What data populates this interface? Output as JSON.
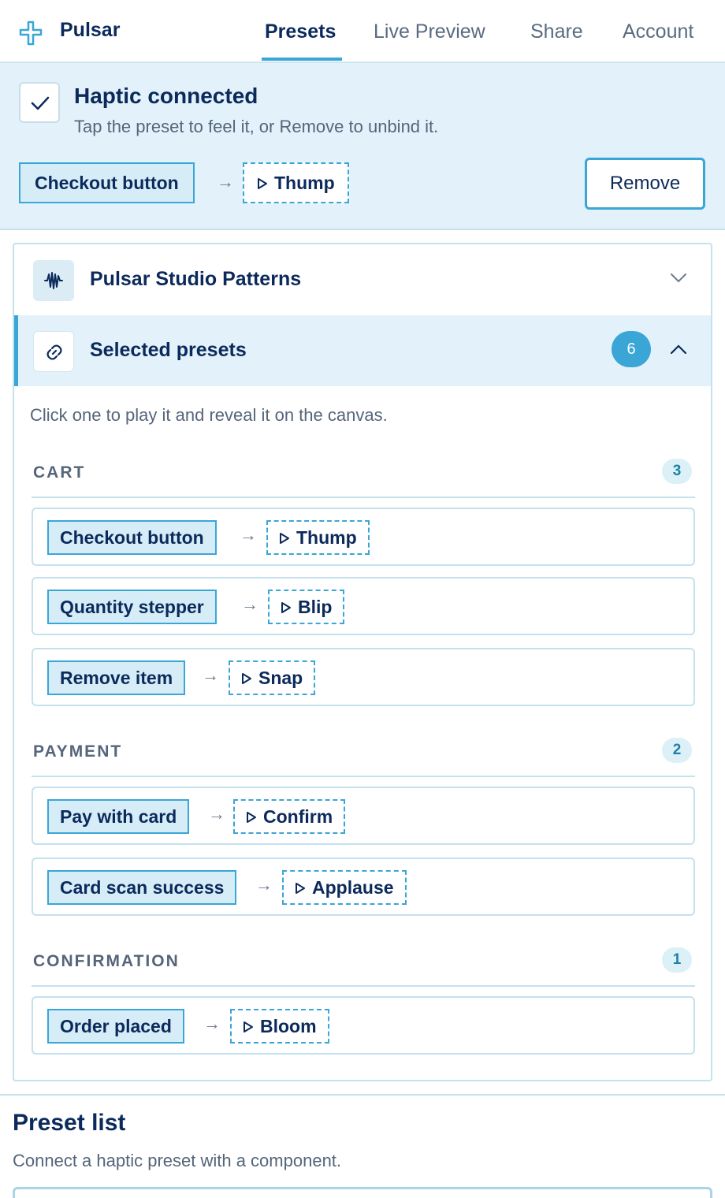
{
  "app": {
    "name": "Pulsar"
  },
  "nav": {
    "tabs": [
      {
        "label": "Presets",
        "active": true
      },
      {
        "label": "Live Preview"
      },
      {
        "label": "Share"
      },
      {
        "label": "Account"
      }
    ]
  },
  "banner": {
    "title": "Haptic connected",
    "subtitle": "Tap the preset to feel it, or Remove to unbind it.",
    "component": "Checkout button",
    "preset": "Thump",
    "remove_label": "Remove"
  },
  "accordion": {
    "patterns_title": "Pulsar Studio Patterns",
    "selected_title": "Selected presets",
    "selected_count": "6",
    "hint": "Click one to play it and reveal it on the canvas.",
    "groups": [
      {
        "label": "CART",
        "count": "3",
        "items": [
          {
            "component": "Checkout button",
            "preset": "Thump"
          },
          {
            "component": "Quantity stepper",
            "preset": "Blip"
          },
          {
            "component": "Remove item",
            "preset": "Snap"
          }
        ]
      },
      {
        "label": "PAYMENT",
        "count": "2",
        "items": [
          {
            "component": "Pay with card",
            "preset": "Confirm"
          },
          {
            "component": "Card scan success",
            "preset": "Applause"
          }
        ]
      },
      {
        "label": "CONFIRMATION",
        "count": "1",
        "items": [
          {
            "component": "Order placed",
            "preset": "Bloom"
          }
        ]
      }
    ]
  },
  "preset_list": {
    "title": "Preset list",
    "subtitle": "Connect a haptic preset with a component."
  },
  "colors": {
    "accent": "#3aa6d6",
    "text": "#0b2a5b",
    "banner_bg": "#e3f2fa"
  },
  "icons": {
    "logo": "plus-wave-logo-icon",
    "check": "check-icon",
    "patterns": "waveform-icon",
    "selected": "link-icon"
  }
}
